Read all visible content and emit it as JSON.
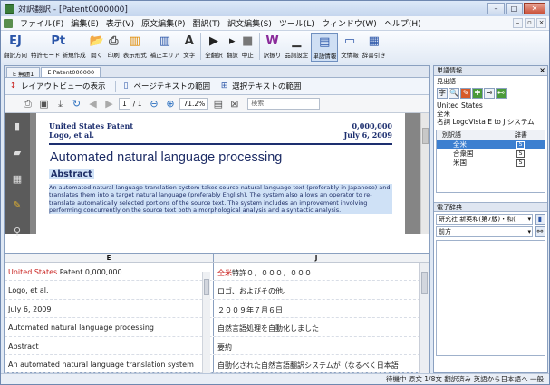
{
  "window": {
    "title": "対訳翻訳 - [Patent0000000]"
  },
  "menu": [
    "ファイル(F)",
    "編集(E)",
    "表示(V)",
    "原文編集(P)",
    "翻訳(T)",
    "訳文編集(S)",
    "ツール(L)",
    "ウィンドウ(W)",
    "ヘルプ(H)"
  ],
  "toolbar": [
    {
      "icon": "translate-direction-icon",
      "glyph": "EJ",
      "label": "翻訳方向"
    },
    {
      "icon": "feature-setting-icon",
      "glyph": "Pt",
      "label": "特許モード 新規作成"
    },
    {
      "icon": "open-icon",
      "glyph": "📂",
      "label": "開く"
    },
    {
      "icon": "print-icon",
      "glyph": "⎙",
      "label": "印刷"
    },
    {
      "icon": "display-format-icon",
      "glyph": "▥",
      "label": "表示形式"
    },
    {
      "icon": "correction-area-icon",
      "glyph": "▥",
      "label": "補正エリア"
    },
    {
      "icon": "text-icon",
      "glyph": "A",
      "label": "文字"
    },
    {
      "icon": "translate-all-icon",
      "glyph": "▶",
      "label": "全翻訳"
    },
    {
      "icon": "translate-icon",
      "glyph": "▸",
      "label": "翻訳"
    },
    {
      "icon": "stop-icon",
      "glyph": "■",
      "label": "中止"
    },
    {
      "icon": "alt-translation-icon",
      "glyph": "W",
      "label": "訳振り"
    },
    {
      "icon": "quality-setting-icon",
      "glyph": "▁",
      "label": "品詞設定"
    },
    {
      "icon": "word-info-icon",
      "glyph": "▤",
      "label": "単語情報"
    },
    {
      "icon": "sentence-info-icon",
      "glyph": "▭",
      "label": "文情報"
    },
    {
      "icon": "dictionary-lookup-icon",
      "glyph": "▦",
      "label": "辞書引き"
    }
  ],
  "tabs": [
    {
      "label": "E 無題1"
    },
    {
      "label": "E Patent000000"
    }
  ],
  "view_bar": {
    "layout": "レイアウトビューの表示",
    "page_text": "ページテキストの範囲",
    "selected_text": "選択テキストの範囲"
  },
  "pdf_toolbar": {
    "page": "1",
    "pages": "/ 1",
    "zoom": "71.2%",
    "search_placeholder": "検索"
  },
  "pdf_page": {
    "left_top": "United States Patent",
    "left_bottom": "Logo, et al.",
    "right_top": "0,000,000",
    "right_bottom": "July 6, 2009",
    "title": "Automated natural language processing",
    "abstract_heading": "Abstract",
    "abstract_text": "An automated natural language translation system takes source natural language text (preferably in Japanese) and translates them into a target natural language (preferably English). The system also allows an operator to re-translate automatically selected portions of the source text. The system includes an improvement involving performing concurrently on the source text both a morphological analysis and a syntactic analysis."
  },
  "grid": {
    "col_e": "E",
    "col_j": "J",
    "rows": [
      {
        "e_red": "United States",
        "e": " Patent 0,000,000",
        "j_red": "全米",
        "j": "特許０，０００，０００"
      },
      {
        "e_red": "",
        "e": "Logo, et al.",
        "j_red": "",
        "j": "ロゴ、およびその他。"
      },
      {
        "e_red": "",
        "e": "July 6, 2009",
        "j_red": "",
        "j": "２００９年７月６日"
      },
      {
        "e_red": "",
        "e": "Automated natural language processing",
        "j_red": "",
        "j": "自然言語処理を自動化しました"
      },
      {
        "e_red": "",
        "e": "Abstract",
        "j_red": "",
        "j": "要約"
      },
      {
        "e_red": "",
        "e": "An automated natural language translation system",
        "j_red": "",
        "j": "自動化された自然言語翻訳システムが（なるべく日本語"
      }
    ]
  },
  "word_panel": {
    "title": "単語情報",
    "sub": "見出語",
    "term": "United States",
    "word": "全米",
    "source": "名詞 LogoVista E to J システム",
    "col_word": "別訳語",
    "col_dict": "辞書",
    "alternatives": [
      {
        "word": "全米",
        "dict": "S",
        "selected": true
      },
      {
        "word": "合衆国",
        "dict": "S",
        "selected": false
      },
      {
        "word": "米国",
        "dict": "S",
        "selected": false
      }
    ]
  },
  "dict_panel": {
    "title": "電子辞典",
    "dictionary": "研究社 新英和(第7版)・和(",
    "search_mode": "前方"
  },
  "status": "待機中 原文 1/8文 翻訳済み 英語から日本語へ 一般"
}
